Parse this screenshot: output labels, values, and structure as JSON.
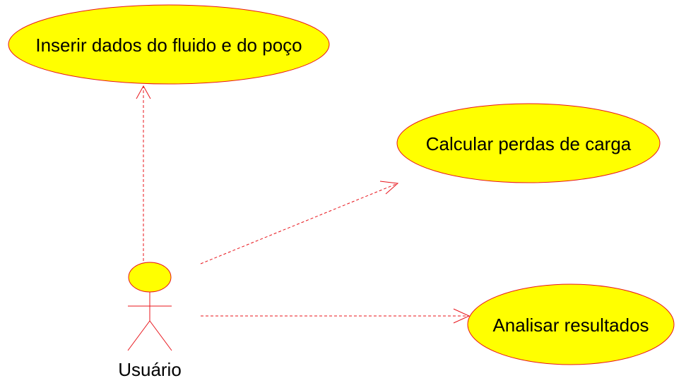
{
  "colors": {
    "fill": "#ffff00",
    "stroke": "#e8141b",
    "text": "#000000"
  },
  "actor": {
    "label": "Usuário"
  },
  "use_cases": [
    {
      "label": "Inserir dados do fluido e do poço"
    },
    {
      "label": "Calcular perdas de carga"
    },
    {
      "label": "Analisar resultados"
    }
  ]
}
